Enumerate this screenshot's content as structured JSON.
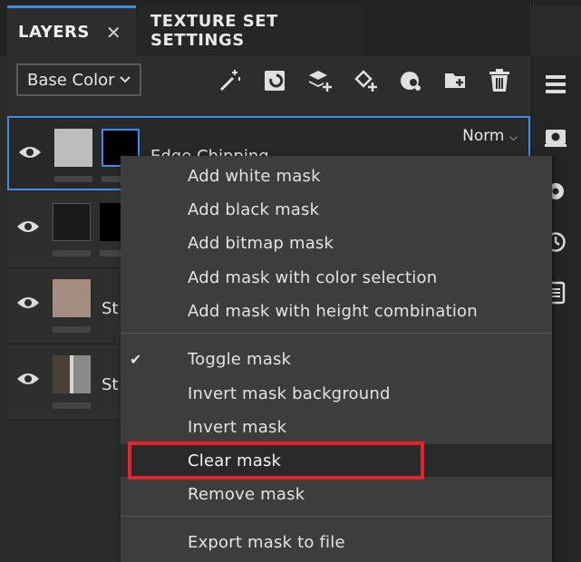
{
  "tabs": {
    "layers_label": "LAYERS",
    "layers_close": "✕",
    "texture_set_label": "TEXTURE SET SETTINGS"
  },
  "toolbar": {
    "channel_value": "Base Color",
    "tools": [
      "magic-wand-icon",
      "fill-layer-icon",
      "add-layer-icon",
      "add-fill-icon",
      "effect-icon",
      "add-folder-icon",
      "delete-icon"
    ]
  },
  "layers": [
    {
      "label": "Edge Chipping",
      "blend": "Norm",
      "thumb_color": "#bdbdbd"
    },
    {
      "label": "",
      "thumb_color": "#1a1a1a"
    },
    {
      "label": "St",
      "thumb_color": "#a58c80"
    },
    {
      "label": "St",
      "thumb_color": "#6a6a6a"
    }
  ],
  "menu": {
    "add_white": "Add white mask",
    "add_black": "Add black mask",
    "add_bitmap": "Add bitmap mask",
    "add_color_sel": "Add mask with color selection",
    "add_height": "Add mask with height combination",
    "toggle": "Toggle mask",
    "toggle_check": "✔",
    "invert_bg": "Invert mask background",
    "invert": "Invert mask",
    "clear": "Clear mask",
    "remove": "Remove mask",
    "export": "Export mask to file"
  },
  "colors": {
    "accent": "#3d8ee8",
    "highlight": "#e8222a"
  }
}
